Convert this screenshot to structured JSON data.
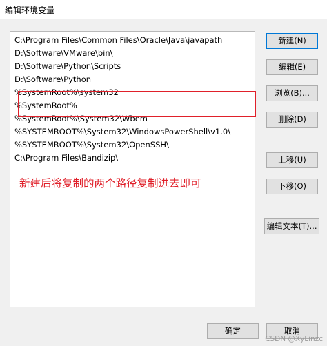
{
  "window": {
    "title": "编辑环境变量"
  },
  "path_list": {
    "items": [
      "C:\\Program Files\\Common Files\\Oracle\\Java\\javapath",
      "D:\\Software\\VMware\\bin\\",
      "D:\\Software\\Python\\Scripts",
      "D:\\Software\\Python",
      "%SystemRoot%\\system32",
      "%SystemRoot%",
      "%SystemRoot%\\System32\\Wbem",
      "%SYSTEMROOT%\\System32\\WindowsPowerShell\\v1.0\\",
      "%SYSTEMROOT%\\System32\\OpenSSH\\",
      "C:\\Program Files\\Bandizip\\"
    ]
  },
  "annotation": {
    "text": "新建后将复制的两个路径复制进去即可",
    "color": "#e0202a"
  },
  "buttons": {
    "new": "新建(N)",
    "edit": "编辑(E)",
    "browse": "浏览(B)...",
    "delete": "删除(D)",
    "move_up": "上移(U)",
    "move_down": "下移(O)",
    "edit_text": "编辑文本(T)...",
    "ok": "确定",
    "cancel": "取消"
  },
  "watermark": {
    "text": "CSDN @XyLinzc"
  }
}
